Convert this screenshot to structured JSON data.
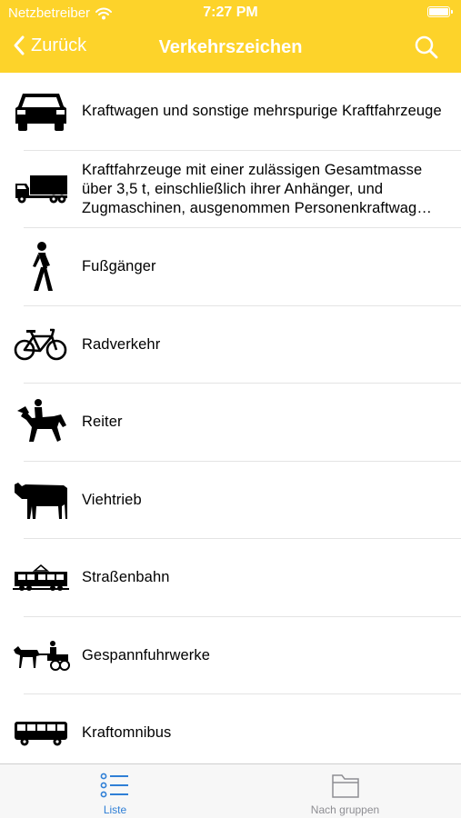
{
  "status": {
    "carrier": "Netzbetreiber",
    "time": "7:27 PM",
    "battery_level": 1.0
  },
  "nav": {
    "back_label": "Zurück",
    "title": "Verkehrszeichen"
  },
  "items": [
    {
      "label": "Kraftwagen und sonstige mehrspurige Kraftfahrzeuge",
      "icon": "car-icon"
    },
    {
      "label": "Kraftfahrzeuge mit einer zulässigen Gesamtmasse über 3,5 t, einschließlich ihrer Anhänger, und Zugmaschinen, ausgenommen Personenkraftwag…",
      "icon": "truck-icon"
    },
    {
      "label": "Fußgänger",
      "icon": "pedestrian-icon"
    },
    {
      "label": "Radverkehr",
      "icon": "bicycle-icon"
    },
    {
      "label": "Reiter",
      "icon": "horse-rider-icon"
    },
    {
      "label": "Viehtrieb",
      "icon": "cow-icon"
    },
    {
      "label": "Straßenbahn",
      "icon": "tram-icon"
    },
    {
      "label": "Gespannfuhrwerke",
      "icon": "horse-carriage-icon"
    },
    {
      "label": "Kraftomnibus",
      "icon": "bus-icon"
    }
  ],
  "tabs": [
    {
      "label": "Liste",
      "icon": "list-icon",
      "selected": true
    },
    {
      "label": "Nach gruppen",
      "icon": "folder-icon",
      "selected": false
    }
  ],
  "colors": {
    "accent": "#fdd32a",
    "tab_active": "#2f7fd6",
    "tab_inactive": "#8e8e93"
  }
}
